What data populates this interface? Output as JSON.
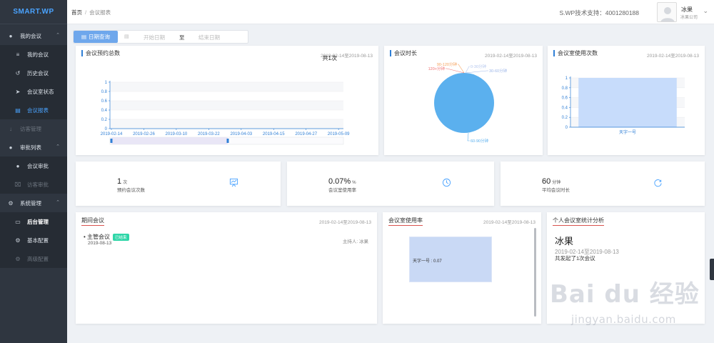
{
  "brand": "SMART.WP",
  "sidebar": {
    "groups": [
      {
        "label": "我的会议",
        "icon": "users-icon",
        "items": [
          {
            "label": "我的会议",
            "icon": "list-icon"
          },
          {
            "label": "历史会议",
            "icon": "history-icon"
          },
          {
            "label": "会议室状态",
            "icon": "send-icon"
          },
          {
            "label": "会议报表",
            "icon": "report-icon"
          }
        ]
      },
      {
        "label": "访客管理",
        "icon": "visitor-icon",
        "items": []
      },
      {
        "label": "审批列表",
        "icon": "user-icon",
        "items": [
          {
            "label": "会议审批",
            "icon": "user-icon"
          },
          {
            "label": "访客审批",
            "icon": "visitor-icon"
          }
        ]
      },
      {
        "label": "系统管理",
        "icon": "settings-icon",
        "items": [
          {
            "label": "后台管理",
            "icon": "monitor-icon"
          },
          {
            "label": "基本配置",
            "icon": "gear-icon"
          },
          {
            "label": "高级配置",
            "icon": "gear-icon"
          }
        ]
      }
    ]
  },
  "header": {
    "breadcrumb_home": "首页",
    "breadcrumb_sep": "/",
    "breadcrumb_current": "会议报表",
    "support": "S.WP技术支持：4001280188",
    "user_name": "冰果",
    "user_company": "冰果公司"
  },
  "filter": {
    "button": "日期查询",
    "start_placeholder": "开始日期",
    "to": "至",
    "end_placeholder": "结束日期"
  },
  "cards": {
    "bookings": {
      "title": "会议预约总数",
      "date": "2019-02-14至2019-08-13",
      "total": "共1次"
    },
    "duration": {
      "title": "会议时长",
      "date": "2019-02-14至2019-08-13"
    },
    "room_usage_count": {
      "title": "会议室使用次数",
      "date": "2019-02-14至2019-08-13"
    },
    "period_meetings": {
      "title": "期间会议",
      "date": "2019-02-14至2019-08-13"
    },
    "usage_rate": {
      "title": "会议室使用率",
      "date": "2019-02-14至2019-08-13"
    },
    "personal": {
      "title": "个人会议室统计分析",
      "name": "冰果",
      "date": "2019-02-14至2019-08-13",
      "summary": "共发起了1次会议"
    }
  },
  "stats": [
    {
      "num": "1",
      "unit": "次",
      "label": "预约会议次数",
      "icon": "presentation-icon"
    },
    {
      "num": "0.07%",
      "unit": "%",
      "label": "会议室使用率",
      "icon": "clock-icon"
    },
    {
      "num": "60",
      "unit": "分钟",
      "label": "平均会议时长",
      "icon": "refresh-icon"
    }
  ],
  "meeting": {
    "title": "主管会议",
    "status": "已结束",
    "date": "2019-08-13",
    "host_label": "主持人:",
    "host": "冰果"
  },
  "colors": {
    "accent": "#2f7fd6",
    "sidebar_bg": "#2f3640",
    "pie_main": "#5bb0ee",
    "bar_fill": "#c7dcfb",
    "tag": "#2fd6a8",
    "underline": "#d9534f"
  },
  "chart_data": [
    {
      "type": "line",
      "title": "会议预约总数",
      "x": [
        "2019-02-14",
        "2019-02-26",
        "2019-03-10",
        "2019-03-22",
        "2019-04-03",
        "2019-04-15",
        "2019-04-27",
        "2019-05-09"
      ],
      "yticks": [
        "0",
        "0.2",
        "0.4",
        "0.6",
        "0.8",
        "1"
      ],
      "ylim": [
        0,
        1
      ],
      "grid": true
    },
    {
      "type": "pie",
      "title": "会议时长",
      "labels": [
        "0-30分钟",
        "30-60分钟",
        "60-90分钟",
        "90-120分钟",
        "120+分钟"
      ],
      "values": [
        0,
        0,
        1,
        0,
        0
      ],
      "colors": [
        "#b4c7ef",
        "#9db6e8",
        "#5bb0ee",
        "#f5a05a",
        "#f07070"
      ]
    },
    {
      "type": "bar",
      "title": "会议室使用次数",
      "categories": [
        "天字一号"
      ],
      "values": [
        1
      ],
      "yticks": [
        "0",
        "0.2",
        "0.4",
        "0.6",
        "0.8",
        "1"
      ],
      "ylim": [
        0,
        1
      ],
      "grid": true
    },
    {
      "type": "treemap",
      "title": "会议室使用率",
      "labels": [
        "天字一号 : 0.07"
      ],
      "values": [
        0.07
      ]
    }
  ],
  "watermark": {
    "brand": "Bai du 经验",
    "url": "jingyan.baidu.com"
  }
}
